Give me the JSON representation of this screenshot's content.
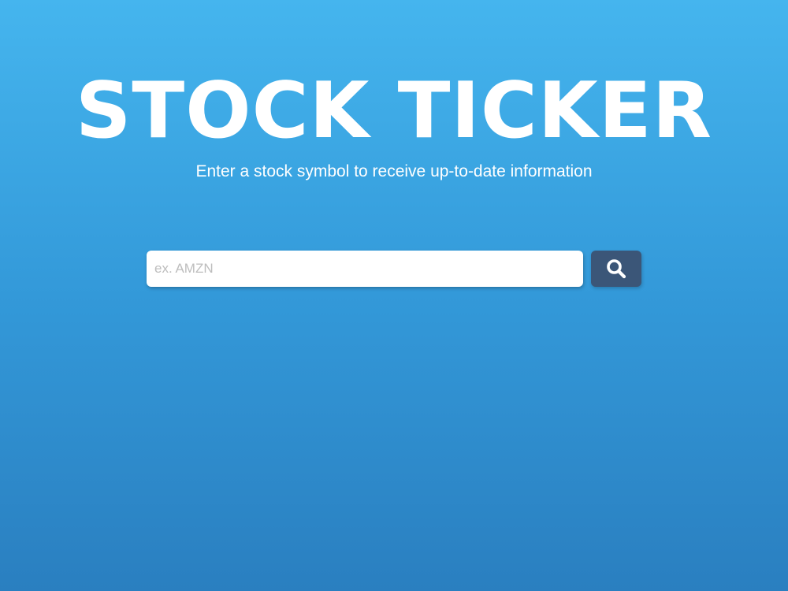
{
  "header": {
    "title": "STOCK TICKER",
    "subtitle": "Enter a stock symbol to receive up-to-date information"
  },
  "search": {
    "placeholder": "ex. AMZN",
    "value": "",
    "button_icon": "search-icon"
  },
  "colors": {
    "background_top": "#45b5ee",
    "background_bottom": "#2a7fc0",
    "button": "#3b5678",
    "text": "#ffffff",
    "placeholder": "#bdbdbd"
  }
}
